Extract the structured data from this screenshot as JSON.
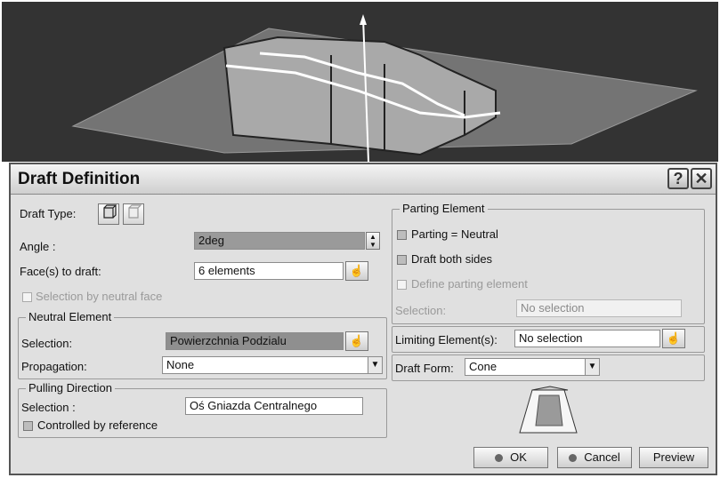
{
  "dialog": {
    "title": "Draft Definition",
    "help_label": "?",
    "close_label": "✕"
  },
  "left": {
    "draft_type_label": "Draft Type:",
    "angle_label": "Angle :",
    "angle_value": "2deg",
    "faces_label": "Face(s) to draft:",
    "faces_value": "6 elements",
    "selection_by_neutral_face": "Selection by neutral face",
    "neutral_element": {
      "title": "Neutral Element",
      "selection_label": "Selection:",
      "selection_value": "Powierzchnia Podzialu",
      "propagation_label": "Propagation:",
      "propagation_value": "None"
    },
    "pulling_direction": {
      "title": "Pulling Direction",
      "selection_label": "Selection :",
      "selection_value": "Oś Gniazda Centralnego",
      "controlled_by_reference": "Controlled by reference"
    }
  },
  "right": {
    "parting_element": {
      "title": "Parting Element",
      "parting_neutral": "Parting = Neutral",
      "draft_both_sides": "Draft both sides",
      "define_parting_element": "Define parting element",
      "selection_label": "Selection:",
      "selection_value": "No selection"
    },
    "limiting_label": "Limiting Element(s):",
    "limiting_value": "No selection",
    "draft_form_label": "Draft Form:",
    "draft_form_value": "Cone"
  },
  "buttons": {
    "ok": "OK",
    "cancel": "Cancel",
    "preview": "Preview"
  },
  "icons": {
    "draft_type_basic": "draft-basic-icon",
    "draft_type_variable": "draft-variable-icon",
    "select": "select-element-icon",
    "dropdown": "chevron-down-icon"
  }
}
